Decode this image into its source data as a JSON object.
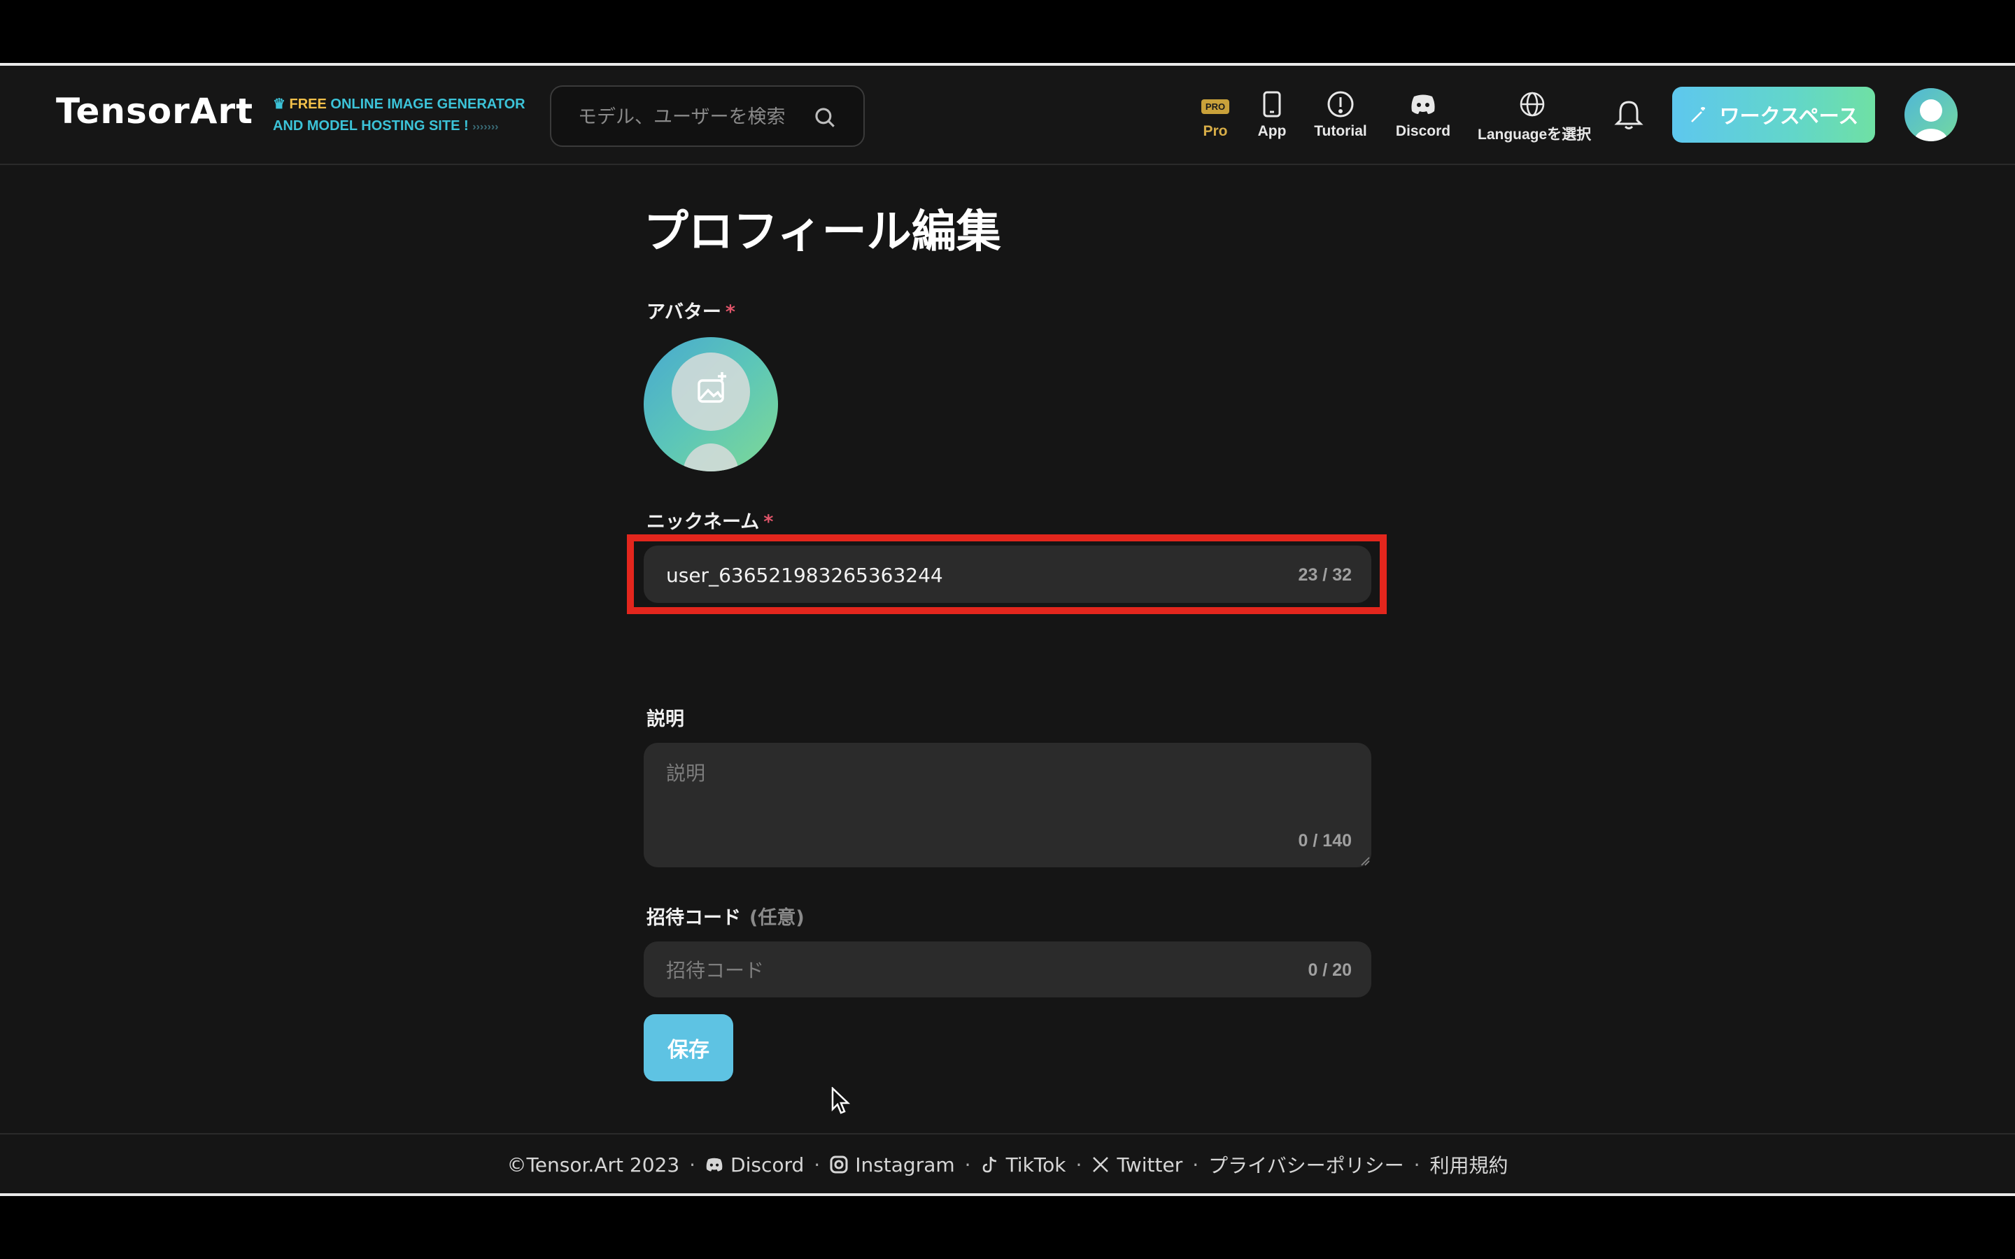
{
  "header": {
    "logo": "TensorArt",
    "tagline_free": "FREE",
    "tagline_line1": "ONLINE IMAGE GENERATOR",
    "tagline_line2": "AND MODEL HOSTING SITE !",
    "tagline_arrows": "›››››››",
    "search_placeholder": "モデル、ユーザーを検索",
    "pro_badge": "PRO",
    "nav": {
      "pro": "Pro",
      "app": "App",
      "tutorial": "Tutorial",
      "discord": "Discord",
      "language": "Languageを選択"
    },
    "workspace_label": "ワークスペース"
  },
  "page": {
    "title": "プロフィール編集",
    "avatar_label": "アバター",
    "required_mark": "*",
    "nickname_label": "ニックネーム",
    "nickname_value": "user_636521983265363244",
    "nickname_counter": "23 / 32",
    "description_label": "説明",
    "description_placeholder": "説明",
    "description_counter": "0 / 140",
    "invite_label": "招待コード",
    "invite_optional": "(任意)",
    "invite_placeholder": "招待コード",
    "invite_counter": "0 / 20",
    "save_label": "保存"
  },
  "footer": {
    "copyright": "©Tensor.Art 2023",
    "separator": "·",
    "discord": "Discord",
    "instagram": "Instagram",
    "tiktok": "TikTok",
    "twitter": "Twitter",
    "privacy": "プライバシーポリシー",
    "terms": "利用規約"
  },
  "colors": {
    "accent": "#5ec3e3",
    "highlight": "#e3261d",
    "required": "#e0556a"
  }
}
